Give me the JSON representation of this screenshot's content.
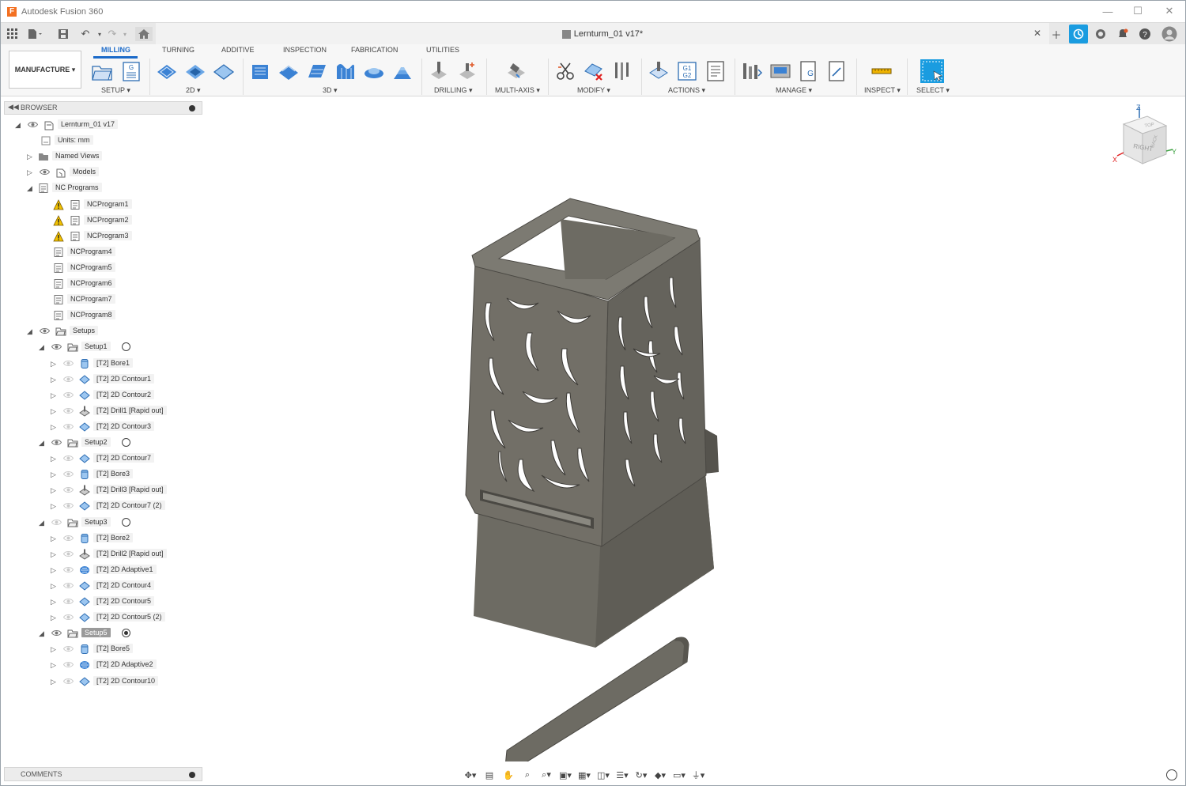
{
  "window": {
    "title": "Autodesk Fusion 360",
    "logo_letter": "F"
  },
  "document_tab": {
    "title": "Lernturm_01 v17*"
  },
  "ribbon": {
    "workspace": "MANUFACTURE ▾",
    "tabs": [
      "MILLING",
      "TURNING",
      "ADDITIVE",
      "INSPECTION",
      "FABRICATION",
      "UTILITIES"
    ],
    "groups": [
      "SETUP ▾",
      "2D ▾",
      "3D ▾",
      "DRILLING ▾",
      "MULTI-AXIS ▾",
      "MODIFY ▾",
      "ACTIONS ▾",
      "MANAGE ▾",
      "INSPECT ▾",
      "SELECT ▾"
    ]
  },
  "browser": {
    "title": "BROWSER",
    "items": [
      {
        "label": "Lernturm_01 v17",
        "indent": 0
      },
      {
        "label": "Units: mm",
        "indent": 1
      },
      {
        "label": "Named Views",
        "indent": 1
      },
      {
        "label": "Models",
        "indent": 1
      },
      {
        "label": "NC Programs",
        "indent": 1
      },
      {
        "label": "NCProgram1",
        "indent": 2
      },
      {
        "label": "NCProgram2",
        "indent": 2
      },
      {
        "label": "NCProgram3",
        "indent": 2
      },
      {
        "label": "NCProgram4",
        "indent": 2
      },
      {
        "label": "NCProgram5",
        "indent": 2
      },
      {
        "label": "NCProgram6",
        "indent": 2
      },
      {
        "label": "NCProgram7",
        "indent": 2
      },
      {
        "label": "NCProgram8",
        "indent": 2
      },
      {
        "label": "Setups",
        "indent": 1
      },
      {
        "label": "Setup1",
        "indent": 2
      },
      {
        "label": "[T2] Bore1",
        "indent": 3
      },
      {
        "label": "[T2] 2D Contour1",
        "indent": 3
      },
      {
        "label": "[T2] 2D Contour2",
        "indent": 3
      },
      {
        "label": "[T2] Drill1 [Rapid out]",
        "indent": 3
      },
      {
        "label": "[T2] 2D Contour3",
        "indent": 3
      },
      {
        "label": "Setup2",
        "indent": 2
      },
      {
        "label": "[T2] 2D Contour7",
        "indent": 3
      },
      {
        "label": "[T2] Bore3",
        "indent": 3
      },
      {
        "label": "[T2] Drill3 [Rapid out]",
        "indent": 3
      },
      {
        "label": "[T2] 2D Contour7 (2)",
        "indent": 3
      },
      {
        "label": "Setup3",
        "indent": 2
      },
      {
        "label": "[T2] Bore2",
        "indent": 3
      },
      {
        "label": "[T2] Drill2 [Rapid out]",
        "indent": 3
      },
      {
        "label": "[T2] 2D Adaptive1",
        "indent": 3
      },
      {
        "label": "[T2] 2D Contour4",
        "indent": 3
      },
      {
        "label": "[T2] 2D Contour5",
        "indent": 3
      },
      {
        "label": "[T2] 2D Contour5 (2)",
        "indent": 3
      },
      {
        "label": "Setup5",
        "indent": 2
      },
      {
        "label": "[T2] Bore5",
        "indent": 3
      },
      {
        "label": "[T2] 2D Adaptive2",
        "indent": 3
      },
      {
        "label": "[T2] 2D Contour10",
        "indent": 3
      }
    ]
  },
  "comments": {
    "title": "COMMENTS"
  },
  "viewcube": {
    "face_right": "RIGHT",
    "face_top": "TOP",
    "face_back": "BACK",
    "axis_z": "Z",
    "axis_x": "X",
    "axis_y": "Y"
  },
  "colors": {
    "accent": "#1b6ac9",
    "model": "#6d6b63",
    "warning": "#f2c200"
  }
}
